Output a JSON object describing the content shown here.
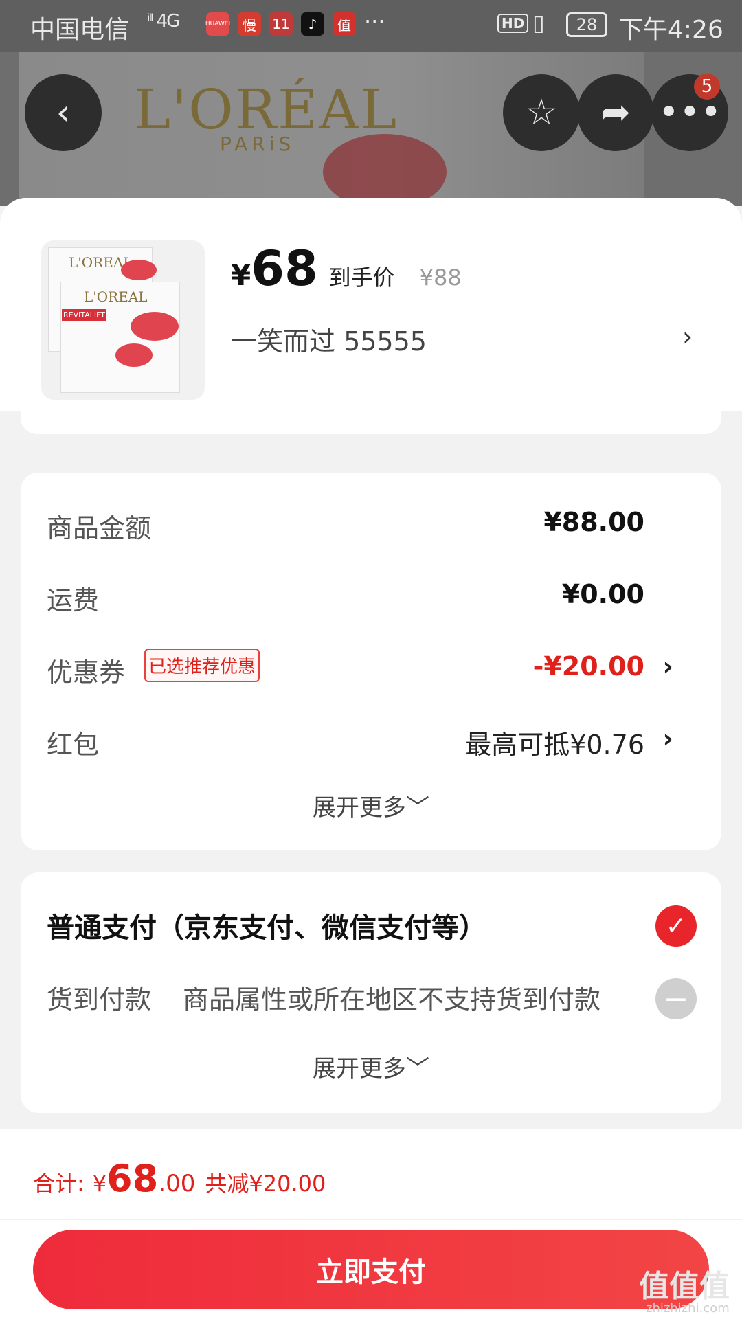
{
  "status_bar": {
    "carrier": "中国电信",
    "network": "4G",
    "more": "···",
    "hd": "HD",
    "battery": "28",
    "time": "下午4:26",
    "apps": [
      {
        "label": "HUAWEI",
        "color": "#e24b4b"
      },
      {
        "label": "慢",
        "color": "#d43c2f"
      },
      {
        "label": "11",
        "color": "#c03a3a"
      },
      {
        "label": "♪",
        "color": "#111111"
      },
      {
        "label": "值",
        "color": "#d4302e"
      }
    ]
  },
  "header": {
    "brand": "L'ORÉAL",
    "brand_sub": "PARiS",
    "menu_badge": "5"
  },
  "product": {
    "price_symbol": "¥",
    "price": "68",
    "price_label": "到手价",
    "original_price": "¥88",
    "spec": "一笑而过  55555",
    "arrow": "›",
    "image_texts": {
      "brand": "L'OREAL",
      "line": "REVITALIFT"
    }
  },
  "summary": {
    "goods_amount": {
      "label": "商品金额",
      "value": "¥88.00"
    },
    "shipping": {
      "label": "运费",
      "value": "¥0.00"
    },
    "coupon": {
      "label": "优惠券",
      "tag": "已选推荐优惠",
      "value": "-¥20.00"
    },
    "red_packet": {
      "label": "红包",
      "value": "最高可抵¥0.76"
    },
    "expand": "展开更多﹀"
  },
  "payment": {
    "normal": "普通支付（京东支付、微信支付等）",
    "cod": "货到付款",
    "cod_desc": "商品属性或所在地区不支持货到付款",
    "expand": "展开更多﹀"
  },
  "footer": {
    "total_label": "合计:",
    "total_symbol": "¥",
    "total_int": "68",
    "total_dec": ".00",
    "reduce": "共减¥20.00",
    "pay_button": "立即支付"
  },
  "watermark": {
    "main": "值值值",
    "site": "zhizhizhi.com"
  },
  "colors": {
    "accent_red": "#e0201b",
    "pay_button": "#ef2b3b"
  }
}
